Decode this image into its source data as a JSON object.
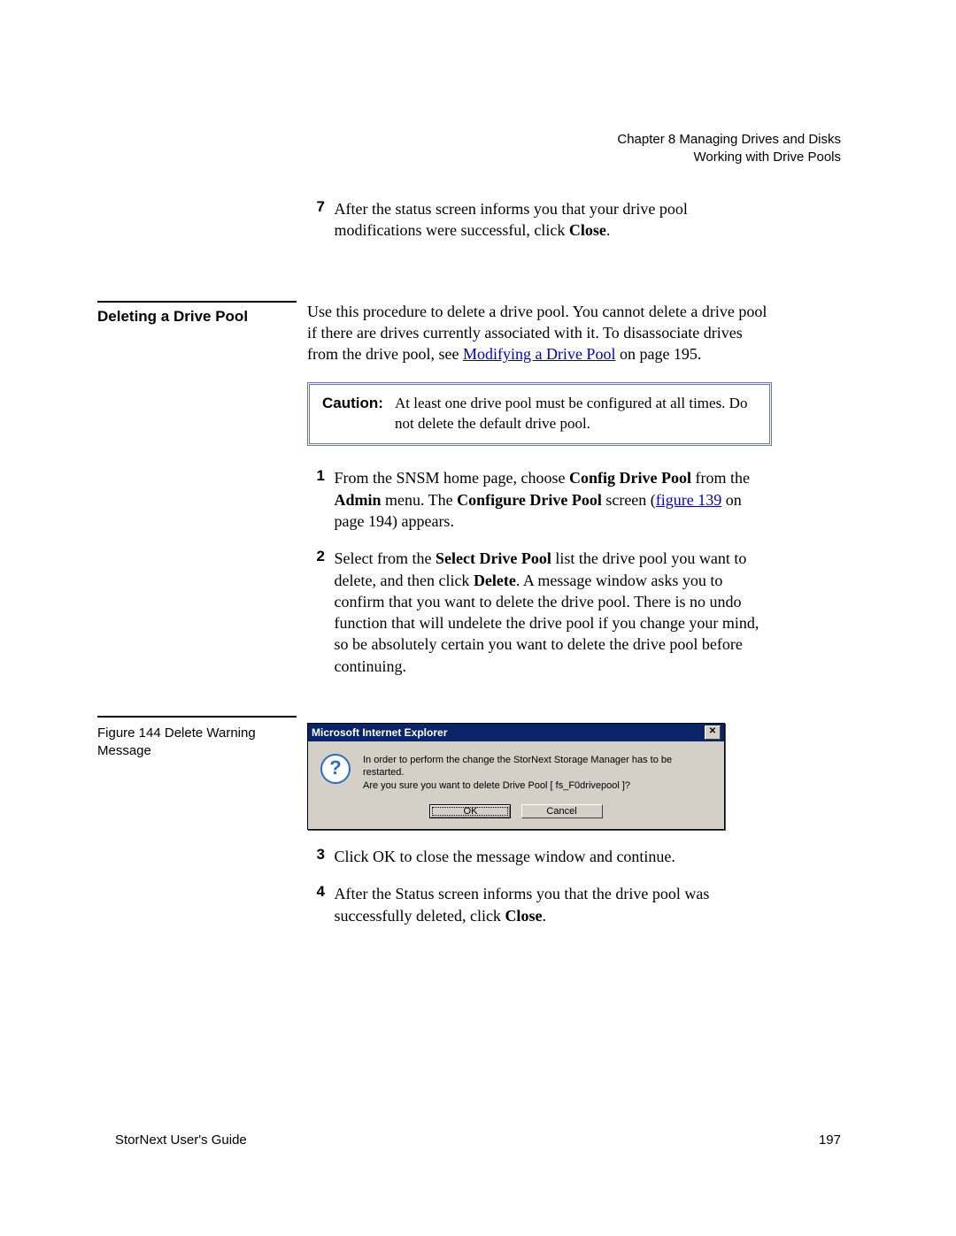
{
  "header": {
    "chapter": "Chapter 8  Managing Drives and Disks",
    "section": "Working with Drive Pools"
  },
  "step7": {
    "num": "7",
    "text_a": "After the status screen informs you that your drive pool modifications were successful, click ",
    "close": "Close",
    "text_b": "."
  },
  "sidebar": {
    "heading": "Deleting a Drive Pool",
    "figure_caption": "Figure 144  Delete Warning Message"
  },
  "intro": {
    "text_a": "Use this procedure to delete a drive pool. You cannot delete a drive pool if there are drives currently associated with it. To disassociate drives from the drive pool, see ",
    "link": "Modifying a Drive Pool",
    "text_b": " on page  195."
  },
  "caution": {
    "label": "Caution:",
    "text": "At least one drive pool must be configured at all times. Do not delete the default drive pool."
  },
  "step1": {
    "num": "1",
    "a": "From the SNSM home page, choose ",
    "b": "Config Drive Pool",
    "c": " from the ",
    "d": "Admin",
    "e": " menu. The ",
    "f": "Configure Drive Pool",
    "g": " screen (",
    "link": "figure 139",
    "h": " on page 194) appears."
  },
  "step2": {
    "num": "2",
    "a": "Select from the ",
    "b": "Select Drive Pool",
    "c": " list the drive pool you want to delete, and then click ",
    "d": "Delete",
    "e": ". A message window asks you to confirm that you want to delete the drive pool. There is no undo function that will undelete the drive pool if you change your mind, so be absolutely certain you want to delete the drive pool before continuing."
  },
  "dialog": {
    "title": "Microsoft Internet Explorer",
    "close_glyph": "✕",
    "icon": "?",
    "msg1": "In order to perform the change the StorNext Storage Manager has to be restarted.",
    "msg2": "Are you sure you want to delete Drive Pool [ fs_F0drivepool ]?",
    "ok": "OK",
    "cancel": "Cancel"
  },
  "step3": {
    "num": "3",
    "text": "Click OK to close the message window and continue."
  },
  "step4": {
    "num": "4",
    "a": "After the Status screen informs you that the drive pool was successfully deleted, click ",
    "b": "Close",
    "c": "."
  },
  "footer": {
    "left": "StorNext User's Guide",
    "right": "197"
  }
}
